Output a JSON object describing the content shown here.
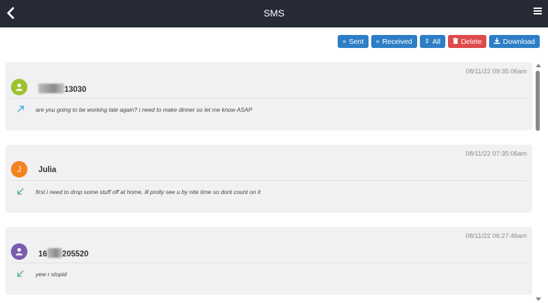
{
  "header": {
    "title": "SMS",
    "back_icon": "chevron-left-icon",
    "menu_icon": "hamburger-menu-icon"
  },
  "toolbar": {
    "sent": "Sent",
    "received": "Received",
    "all": "All",
    "delete": "Delete",
    "download": "Download"
  },
  "colors": {
    "header": "#262a36",
    "button_blue": "#2d7ec6",
    "button_red": "#dd4b4b",
    "card_bg": "#f1f0f2"
  },
  "messages": [
    {
      "timestamp": "08/11/22 09:35:06am",
      "contact_visible": "13030",
      "avatar_letter": "",
      "avatar_color": "#9cc22e",
      "direction": "sent",
      "text": "are you going to be working late again? i need to make dinner so let me know ASAP"
    },
    {
      "timestamp": "08/11/22 07:35:06am",
      "contact_visible": "Julia",
      "avatar_letter": "J",
      "avatar_color": "#f58220",
      "direction": "received",
      "text": "first i need to drop some stuff off at home, ill prolly see u by nite time so dont count on it"
    },
    {
      "timestamp": "08/11/22 06:27:46am",
      "contact_prefix": "16",
      "contact_visible": "205520",
      "avatar_letter": "",
      "avatar_color": "#7b5bb0",
      "direction": "received",
      "text": "yew r stopid"
    }
  ]
}
